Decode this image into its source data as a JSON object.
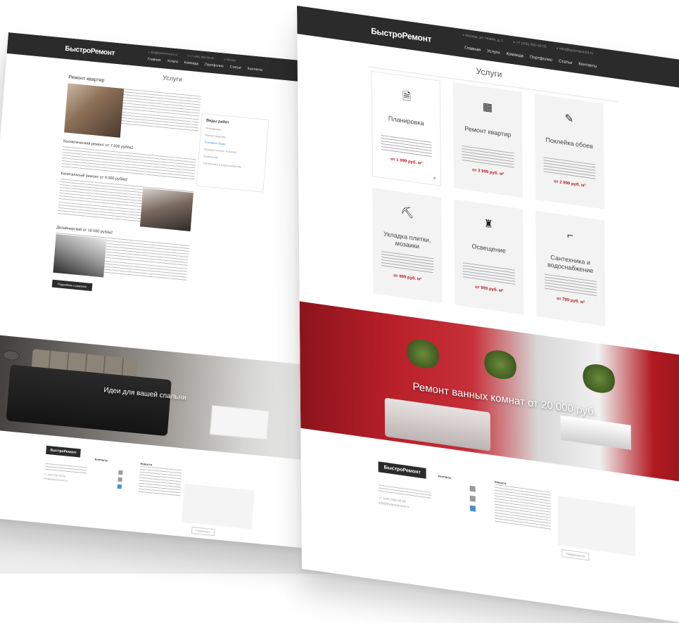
{
  "brand": {
    "name": "БыстроРемонт",
    "accent": "#b31a22",
    "dark": "#2b2b2b"
  },
  "left_page": {
    "contacts": [
      "info@bystroremont.ru",
      "+7 (495) 000-00-00",
      "Москва"
    ],
    "nav": [
      "Главная",
      "Услуги",
      "Команда",
      "Портфолио",
      "Статьи",
      "Контакты"
    ],
    "section_title": "Услуги",
    "article": {
      "title": "Ремонт квартир",
      "h_econ": "Косметический ремонт от 7 000 руб/м2",
      "h_capital": "Капитальный ремонт от 9 000 руб/м2",
      "h_designer": "Дизайнерский от 18 000 руб/м2",
      "more_button": "Подробнее о ремонте"
    },
    "aside": {
      "title": "Виды работ",
      "items": [
        "Планировка",
        "Ремонт квартир",
        "Поклейка обоев",
        "Укладка плитки, мозаики",
        "Освещение",
        "Сантехника и водоснабжение"
      ],
      "active_index": 2
    },
    "banner": {
      "text": "Идеи для вашей спальни"
    },
    "footer": {
      "logo": "БыстроРемонт",
      "contacts_title": "Контакты",
      "news_title": "Новости",
      "phone": "+7 (495) 000-00-00",
      "email": "info@bystroremont.ru",
      "subscribe_button": "Подписаться"
    }
  },
  "right_page": {
    "contacts": [
      "Москва, ул. Новая, д. 1",
      "+7 (495) 000-00-00",
      "info@bystroremont.ru"
    ],
    "nav": [
      "Главная",
      "Услуги",
      "Команда",
      "Портфолио",
      "Статьи",
      "Контакты"
    ],
    "section_title": "Услуги",
    "services": [
      {
        "title": "Планировка",
        "price": "от 1 999 руб. м²",
        "icon": "blueprint-icon"
      },
      {
        "title": "Ремонт квартир",
        "price": "от 3 999 руб. м²",
        "icon": "building-icon"
      },
      {
        "title": "Поклейка обоев",
        "price": "от 2 999 руб. м²",
        "icon": "paint-roller-icon"
      },
      {
        "title": "Укладка плитки, мозаики",
        "price": "от 999 руб. м²",
        "icon": "trowel-icon"
      },
      {
        "title": "Освещение",
        "price": "от 999 руб. м²",
        "icon": "lamp-icon"
      },
      {
        "title": "Сантехника и водоснабжение",
        "price": "от 799 руб. м²",
        "icon": "faucet-icon"
      }
    ],
    "icon_glyphs": [
      "🗎",
      "▦",
      "✎",
      "⛏",
      "♜",
      "⌐"
    ],
    "banner": {
      "text": "Ремонт ванных комнат от 20 000 руб."
    },
    "footer": {
      "logo": "БыстроРемонт",
      "contacts_title": "Контакты",
      "news_title": "Новости",
      "phone": "+7 (495) 000-00-00",
      "email": "info@bystroremont.ru",
      "subscribe_button": "Подписаться"
    }
  }
}
